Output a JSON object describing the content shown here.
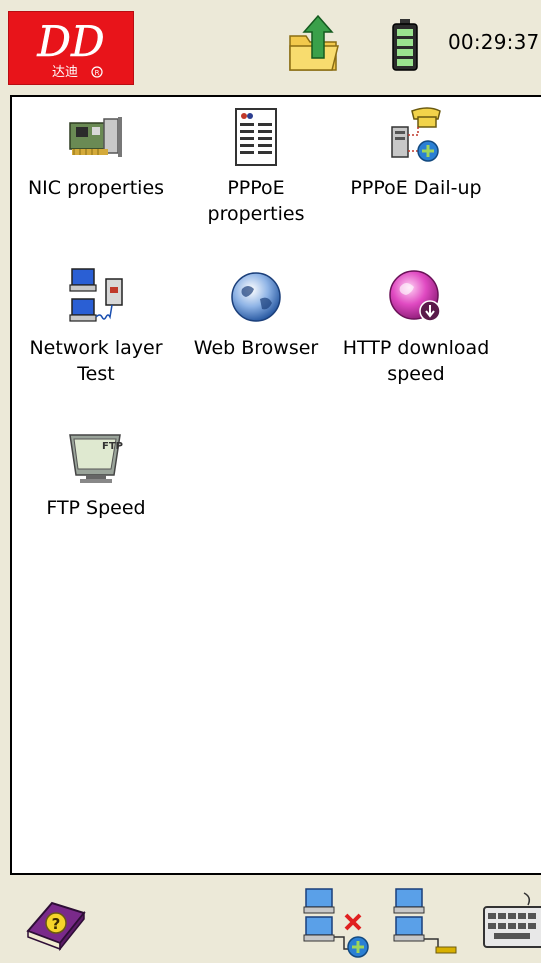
{
  "statusbar": {
    "logo_text": "DD",
    "logo_subtext": "达迪",
    "time": "00:29:37",
    "folder_icon": "folder-up-icon",
    "battery_icon": "battery-icon"
  },
  "apps": [
    {
      "label": "NIC properties",
      "icon": "nic-card-icon"
    },
    {
      "label": "PPPoE\nproperties",
      "icon": "document-list-icon"
    },
    {
      "label": "PPPoE Dail-up",
      "icon": "dialup-phone-icon"
    },
    {
      "label": "Network layer\nTest",
      "icon": "network-computers-icon"
    },
    {
      "label": "Web Browser",
      "icon": "globe-icon"
    },
    {
      "label": "HTTP download\nspeed",
      "icon": "download-globe-icon"
    },
    {
      "label": "FTP Speed",
      "icon": "ftp-folder-icon"
    }
  ],
  "taskbar": {
    "help_icon": "help-book-icon",
    "net_disconnected_icon": "network-disconnected-icon",
    "net_connected_icon": "network-connected-icon",
    "keyboard_icon": "keyboard-icon"
  }
}
